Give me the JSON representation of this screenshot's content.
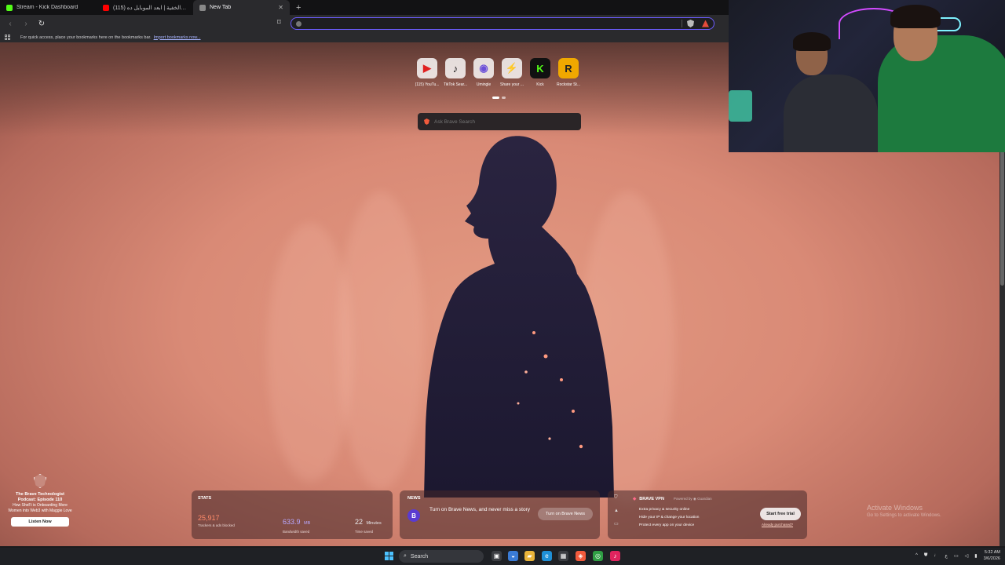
{
  "tabs": [
    {
      "title": "Stream - Kick Dashboard",
      "favicon_color": "#53fc18",
      "active": false
    },
    {
      "title": "(115) الكاميرا الخفية | ابعد الموبايل ده",
      "favicon_color": "#ff0000",
      "active": false
    },
    {
      "title": "New Tab",
      "favicon_color": "#888888",
      "active": true
    }
  ],
  "toolbar": {
    "omnibox_value": ""
  },
  "bookmarks_bar": {
    "message": "For quick access, place your bookmarks here on the bookmarks bar.",
    "import_link": "Import bookmarks now..."
  },
  "top_sites": [
    {
      "label": "(115) YouTu...",
      "glyph": "▶",
      "color": "#e02020"
    },
    {
      "label": "TikTok Sear...",
      "glyph": "♪",
      "color": "#111111"
    },
    {
      "label": "Umingle",
      "glyph": "◉",
      "color": "#6b4fd8"
    },
    {
      "label": "Share your ...",
      "glyph": "⚡",
      "color": "#555555"
    },
    {
      "label": "Kick",
      "glyph": "K",
      "color": "#53fc18"
    },
    {
      "label": "Rockstar St...",
      "glyph": "R",
      "color": "#f0a800"
    }
  ],
  "search": {
    "placeholder": "Ask Brave Search"
  },
  "sponsor": {
    "title": "The Brave Technologist Podcast: Episode 110",
    "text": "How SheFi is Onboarding More Women into Web3 with Maggie Love",
    "button": "Listen Now"
  },
  "stats": {
    "title": "STATS",
    "trackers": {
      "value": "25,917",
      "label": "Trackers & ads blocked",
      "color": "#ff8a6a"
    },
    "bandwidth": {
      "value": "633.9",
      "unit": "MB",
      "label": "Bandwidth saved",
      "color": "#b9a8ff"
    },
    "time": {
      "value": "22",
      "unit": "Minutes",
      "label": "Time saved",
      "color": "#ffffff"
    }
  },
  "news": {
    "title": "NEWS",
    "text": "Turn on Brave News, and never miss a story",
    "button": "Turn on Brave News"
  },
  "vpn": {
    "title": "BRAVE VPN",
    "powered_by": "Powered by ◉ Guardian",
    "features": [
      "Extra privacy & security online",
      "Hide your IP & change your location",
      "Protect every app on your device"
    ],
    "button": "Start free trial",
    "link": "Already purchased?"
  },
  "watermark": {
    "line1": "Activate Windows",
    "line2": "Go to Settings to activate Windows."
  },
  "taskbar": {
    "search_label": "Search",
    "time": "5:32 AM",
    "date": "3/6/2026"
  }
}
